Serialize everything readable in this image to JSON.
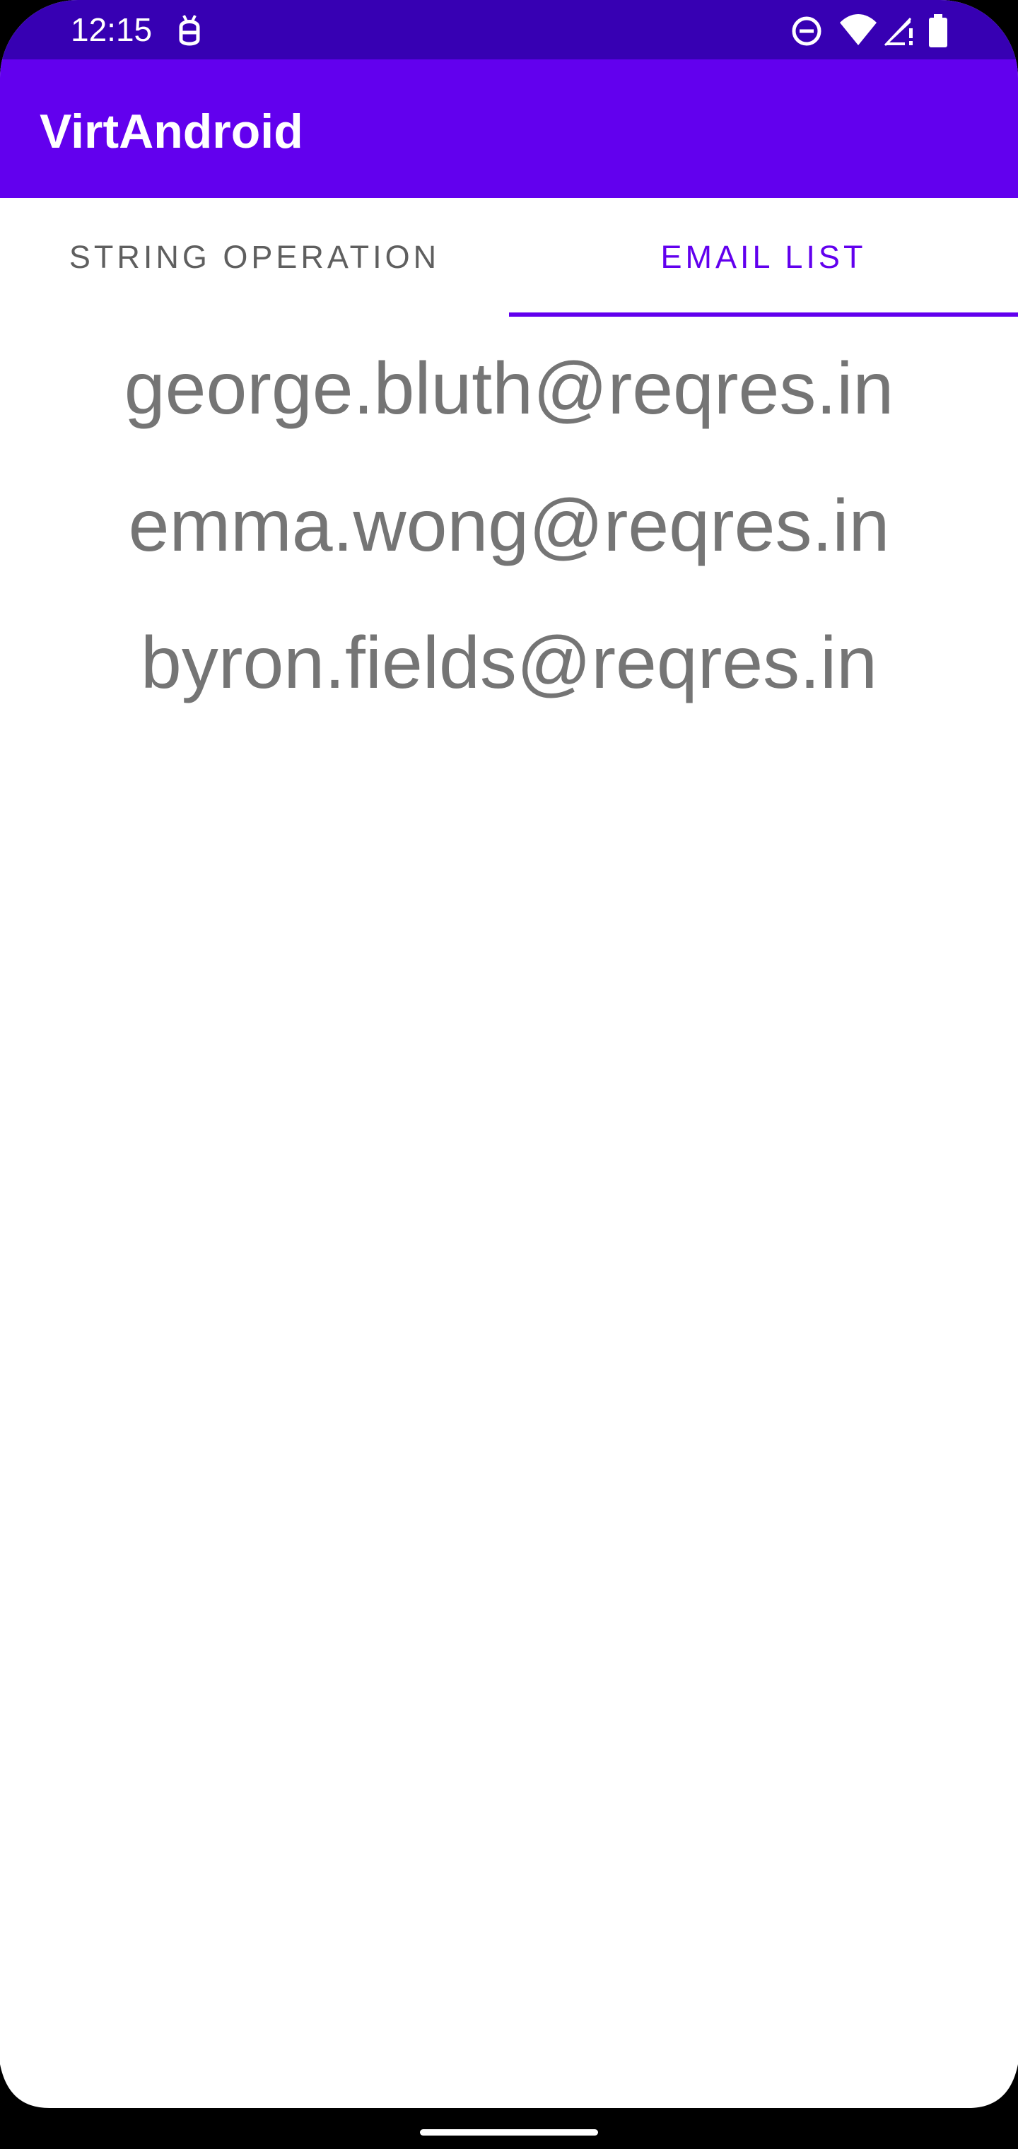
{
  "status_bar": {
    "time": "12:15",
    "icons": [
      "debug-icon",
      "do-not-disturb-icon",
      "wifi-icon",
      "signal-icon",
      "battery-icon"
    ],
    "background": "#3700b3"
  },
  "app_bar": {
    "title": "VirtAndroid",
    "background": "#6200ee"
  },
  "tabs": [
    {
      "label": "STRING OPERATION",
      "selected": false
    },
    {
      "label": "EMAIL LIST",
      "selected": true
    }
  ],
  "accent_color": "#6200ee",
  "emails": [
    "george.bluth@reqres.in",
    "emma.wong@reqres.in",
    "byron.fields@reqres.in"
  ]
}
